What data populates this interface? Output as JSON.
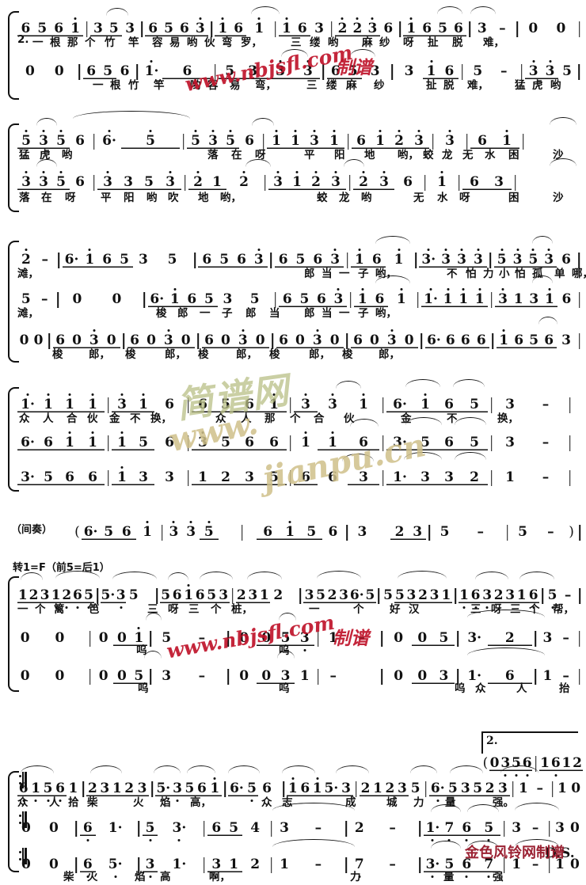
{
  "document": {
    "type": "jianpu-choral-score",
    "language": "zh",
    "title_visible": false,
    "markings": {
      "interlude_label": "（间奏）",
      "key_change": "转1=F（前5=后1）",
      "ending_2_number": "2.",
      "ds_marking": "D.S."
    }
  },
  "watermarks": [
    {
      "text": "www.nbjsfl.com",
      "color": "#c0142b",
      "style": "italic-bold"
    },
    {
      "text": "制谱",
      "color": "#c0142b",
      "style": "bold"
    },
    {
      "text": "www.",
      "color": "#cfc08a",
      "style": "italic-bold"
    },
    {
      "text": "jianpu.cn",
      "color": "#cfc08a",
      "style": "italic-bold"
    },
    {
      "text": "简谱网",
      "color": "#b9bf86",
      "style": "italic-bold"
    },
    {
      "text": "金色风铃网制谱",
      "color": "#9b2233",
      "style": "bold"
    }
  ],
  "systems": [
    {
      "id": "system-1",
      "voices": [
        {
          "id": "s1-v1",
          "notes": "6 5 6 i | 3 5 3 | 6 5 6 3 | i 6  i | i 6 3 | 2 2 3 6 | i 6 5 6 | 3 - | 0  0 |",
          "lyrics": "2.一根那个竹竿容易哟伙弯罗，三缕哟麻纱呀扯脱难，"
        },
        {
          "id": "s1-v2",
          "notes": "0  0 | 6 5 6 | i·  6 | 5 3  3 | 3 3 6 | 6 5 3 | 3  i 6 | 5 - | 3 3 5 |",
          "lyrics": "一根竹竿哟容易弯，三缕麻纱扯脱难，猛虎哟"
        }
      ]
    },
    {
      "id": "system-2",
      "voices": [
        {
          "id": "s2-v1",
          "notes": "5 3 5 6 | 6·   5 | 5 3 5 6 | i i 3 i | 6 i 2 3 | 3 | 6 i |",
          "lyrics": "猛虎哟落在呀平阳地哟，蛟龙无水困沙"
        },
        {
          "id": "s2-v2",
          "notes": "3 3 5 6 | 3 3 5 3 | 2 1  2 | 3 1 2 3 | 2 3 6 | i | 6 3 |",
          "lyrics": "落在呀平阳哟吹地哟，蛟龙哟无水呀困沙"
        }
      ]
    },
    {
      "id": "system-3",
      "voices": [
        {
          "id": "s3-v1",
          "notes": "2 - | 6· i 6 5 | 3   5 | 6 5 6 3 | 6 5 6 3 | i 6 i | 3· 3 3 3 | 5 3 5 3 6 |",
          "lyrics": "滩，郎当一子哟，不怕力小怕孤单哪，"
        },
        {
          "id": "s3-v2",
          "notes": "5 - | 0   0 | 6· i 6 5 | 3   5 | 6 5 6 3 | i 6 i | i· i i i | 3 1 3 i 6 |",
          "lyrics": "滩，梭郎一子郎当郎当一子哟，"
        },
        {
          "id": "s3-v3",
          "notes": "0 0 | 6 0 3 0 | 6 0 3 0 | 6 0 3 0 | 6 0 3 0 | 6 0 3 0 | 6· 6 6 6 | i 6 5 6 3 |",
          "lyrics": "梭郎，梭郎，梭郎，梭郎，梭郎，"
        }
      ]
    },
    {
      "id": "system-4",
      "voices": [
        {
          "id": "s4-v1",
          "notes": "i· i  i i | 3 i 6 | 6 5 6 i | 3  3  i | 6·  i 6 5 | 3   - |",
          "lyrics": "众人合伙金不换，众人那个合伙金不换，"
        },
        {
          "id": "s4-v2",
          "notes": "6· 6  i i | i 5 6 | 3 5 6 6 | i  i  6 | 3·  5 6 5 | 3   - |",
          "lyrics": ""
        },
        {
          "id": "s4-v3",
          "notes": "3· 5  6 6 | i 3 3 | 1 2 3 5 | 6  6  3 | 1·  3 3 2 | 1   - |",
          "lyrics": ""
        }
      ]
    },
    {
      "id": "system-5-interlude",
      "label": "（间奏）",
      "voices": [
        {
          "id": "s5-v1",
          "notes": "( 6· 5 6 i | 3 3 5 | 6 i 5 6 | 3  2 3 | 5   - | 5  - ) |",
          "lyrics": ""
        }
      ]
    },
    {
      "id": "system-6",
      "key_change": "转1=F（前5=后1）",
      "voices": [
        {
          "id": "s6-v1",
          "notes": "1 2 3 1 2 6 5 | 5· 3 5 | 5 6 1 6 5 3 | 2 3 1 2 | 3 5 2 3 6· 5 | 5 5 3 2 3 1 | 1 6 3 2 3 1 6 | 5 - |",
          "lyrics": "一个篱笆三呀三个桩，一个好汉三呀三个帮，"
        },
        {
          "id": "s6-v2",
          "notes": "0  0 | 0  0 1 | 5  - | 0  0 5 3 | 1 - | 0   0 5 | 3·   2 | 3 - |",
          "lyrics": "呜"
        },
        {
          "id": "s6-v3",
          "notes": "0  0 | 0  0 5 | 3  - | 0  0 3 | 1  - | 0   0 3 | 1·   6 | 1 - |",
          "lyrics": "呜呜众人抬"
        }
      ]
    },
    {
      "id": "system-7",
      "ending": {
        "number": "2.",
        "notes": "( 0 3 5 6 | 1 6 1 2 :||"
      },
      "ds": "D.S.",
      "voices": [
        {
          "id": "s7-v1",
          "notes": "6 1 5 6 1 | 2 3 1 2 3 | 5· 3 5 6 1 | 6· 5 6 | i 6 i 5· 3 | 2 1 2 3 5 | 6· 5 3 5 2 3 | 1 - | 1 0 :||",
          "lyrics": "众人拾柴火焰高，众志成城力量强。"
        },
        {
          "id": "s7-v2",
          "notes": "0   0 | 6 1· | 5 3· | 6 5 4 | 3  - | 2  - | 1· 7 6 5 | 3 - | 3 0 :||",
          "lyrics": ""
        },
        {
          "id": "s7-v3",
          "notes": "0   0 | 6 5· | 3 1· | 3 1 2 | 1  - | 7  - | 3· 5 6 7 | 1 - | 1 0 :||",
          "lyrics": "柴火焰高啊，力量强"
        }
      ]
    }
  ]
}
